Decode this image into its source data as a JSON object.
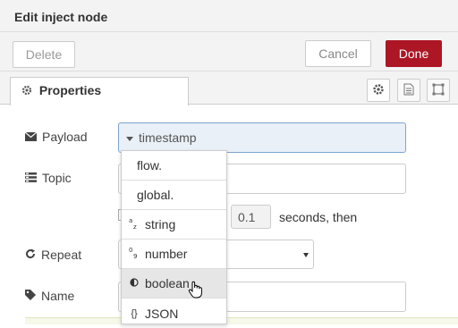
{
  "dialog": {
    "title": "Edit inject node",
    "delete_label": "Delete",
    "cancel_label": "Cancel",
    "done_label": "Done",
    "done_color": "#ad1625"
  },
  "tabs": {
    "active_label": "Properties",
    "icons": [
      "gear-icon",
      "description-icon",
      "appearance-icon"
    ]
  },
  "form": {
    "payload": {
      "label": "Payload",
      "type_value": "timestamp"
    },
    "topic": {
      "label": "Topic",
      "value": ""
    },
    "inject_once": {
      "seconds_value": "0.1",
      "seconds_suffix": "seconds, then"
    },
    "repeat": {
      "label": "Repeat",
      "value": ""
    },
    "name": {
      "label": "Name",
      "value": ""
    }
  },
  "dropdown": {
    "options": [
      {
        "icon": "",
        "label": "flow."
      },
      {
        "icon": "",
        "label": "global."
      },
      {
        "icon": "az",
        "label": "string"
      },
      {
        "icon": "09",
        "label": "number"
      },
      {
        "icon": "◐",
        "label": "boolean"
      },
      {
        "icon": "{}",
        "label": "JSON"
      }
    ],
    "hovered": "boolean"
  }
}
